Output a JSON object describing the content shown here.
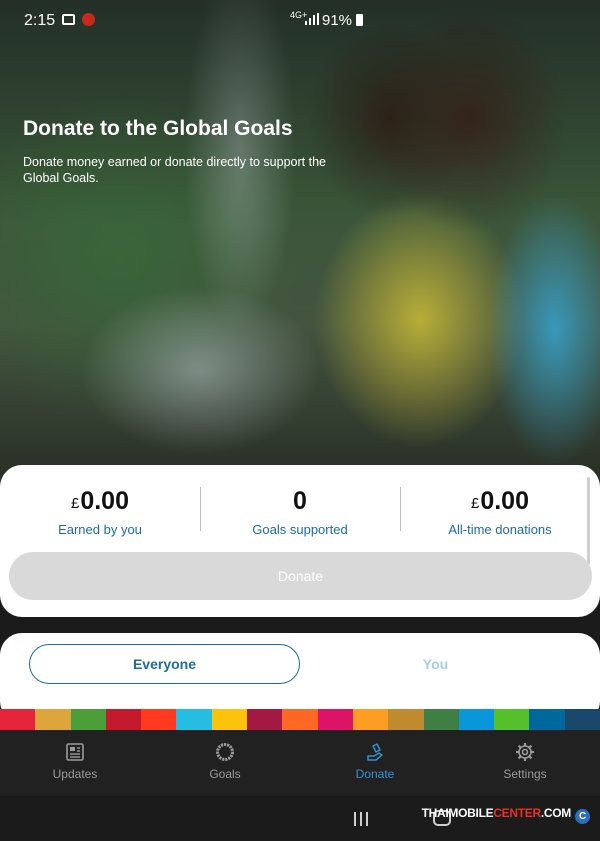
{
  "status_bar": {
    "time": "2:15",
    "network": "4G+",
    "battery": "91%"
  },
  "hero": {
    "title": "Donate to the Global Goals",
    "subtitle": "Donate money earned or donate directly to support the Global Goals."
  },
  "stats": [
    {
      "currency": "£",
      "value": "0.00",
      "label": "Earned by you"
    },
    {
      "currency": "",
      "value": "0",
      "label": "Goals supported"
    },
    {
      "currency": "£",
      "value": "0.00",
      "label": "All-time donations"
    }
  ],
  "donate_button": {
    "label": "Donate",
    "enabled": false
  },
  "segment": {
    "options": [
      "Everyone",
      "You"
    ],
    "selected": "Everyone"
  },
  "sdg_colors": [
    "#e5243b",
    "#dda63a",
    "#4c9f38",
    "#c5192d",
    "#ff3a21",
    "#26bde2",
    "#fcc30b",
    "#a21942",
    "#fd6925",
    "#dd1367",
    "#fd9d24",
    "#bf8b2e",
    "#3f7e44",
    "#0a97d9",
    "#56c02b",
    "#00689d",
    "#19486a"
  ],
  "bottom_nav": {
    "items": [
      {
        "label": "Updates",
        "icon": "newspaper-icon",
        "active": false
      },
      {
        "label": "Goals",
        "icon": "goals-wheel-icon",
        "active": false
      },
      {
        "label": "Donate",
        "icon": "donate-hand-icon",
        "active": true
      },
      {
        "label": "Settings",
        "icon": "gear-icon",
        "active": false
      }
    ]
  },
  "watermark": {
    "prefix": "THAIMOBILE",
    "emphasis": "CENTER",
    "suffix": ".COM",
    "symbol": "C"
  },
  "colors": {
    "accent": "#1f6aa3",
    "active_nav": "#3a8fcf",
    "disabled_button": "#d9d9d9"
  }
}
